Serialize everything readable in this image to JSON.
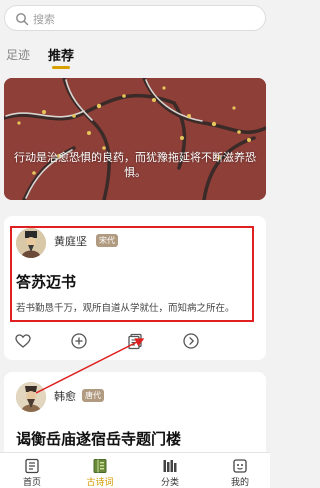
{
  "search": {
    "placeholder": "搜索"
  },
  "tabs": [
    {
      "label": "足迹"
    },
    {
      "label": "推荐"
    }
  ],
  "banner": {
    "quote": "行动是治愈恐惧的良药，而犹豫拖延将不断滋养恐惧。"
  },
  "cards": [
    {
      "author": "黄庭坚",
      "dynasty": "宋代",
      "title": "答苏迈书",
      "excerpt": "若书勤恳千万，观所自道从学就仕，而知病之所在。"
    },
    {
      "author": "韩愈",
      "dynasty": "唐代",
      "title": "谒衡岳庙遂宿岳寺题门楼"
    }
  ],
  "bottom_nav": [
    {
      "label": "首页",
      "icon": "home-icon"
    },
    {
      "label": "古诗词",
      "icon": "book-icon",
      "active": true
    },
    {
      "label": "分类",
      "icon": "category-icon"
    },
    {
      "label": "我的",
      "icon": "user-icon"
    }
  ],
  "colors": {
    "accent": "#d49a00",
    "highlight_red": "#e02020",
    "banner_bg": "#8e3f38"
  }
}
